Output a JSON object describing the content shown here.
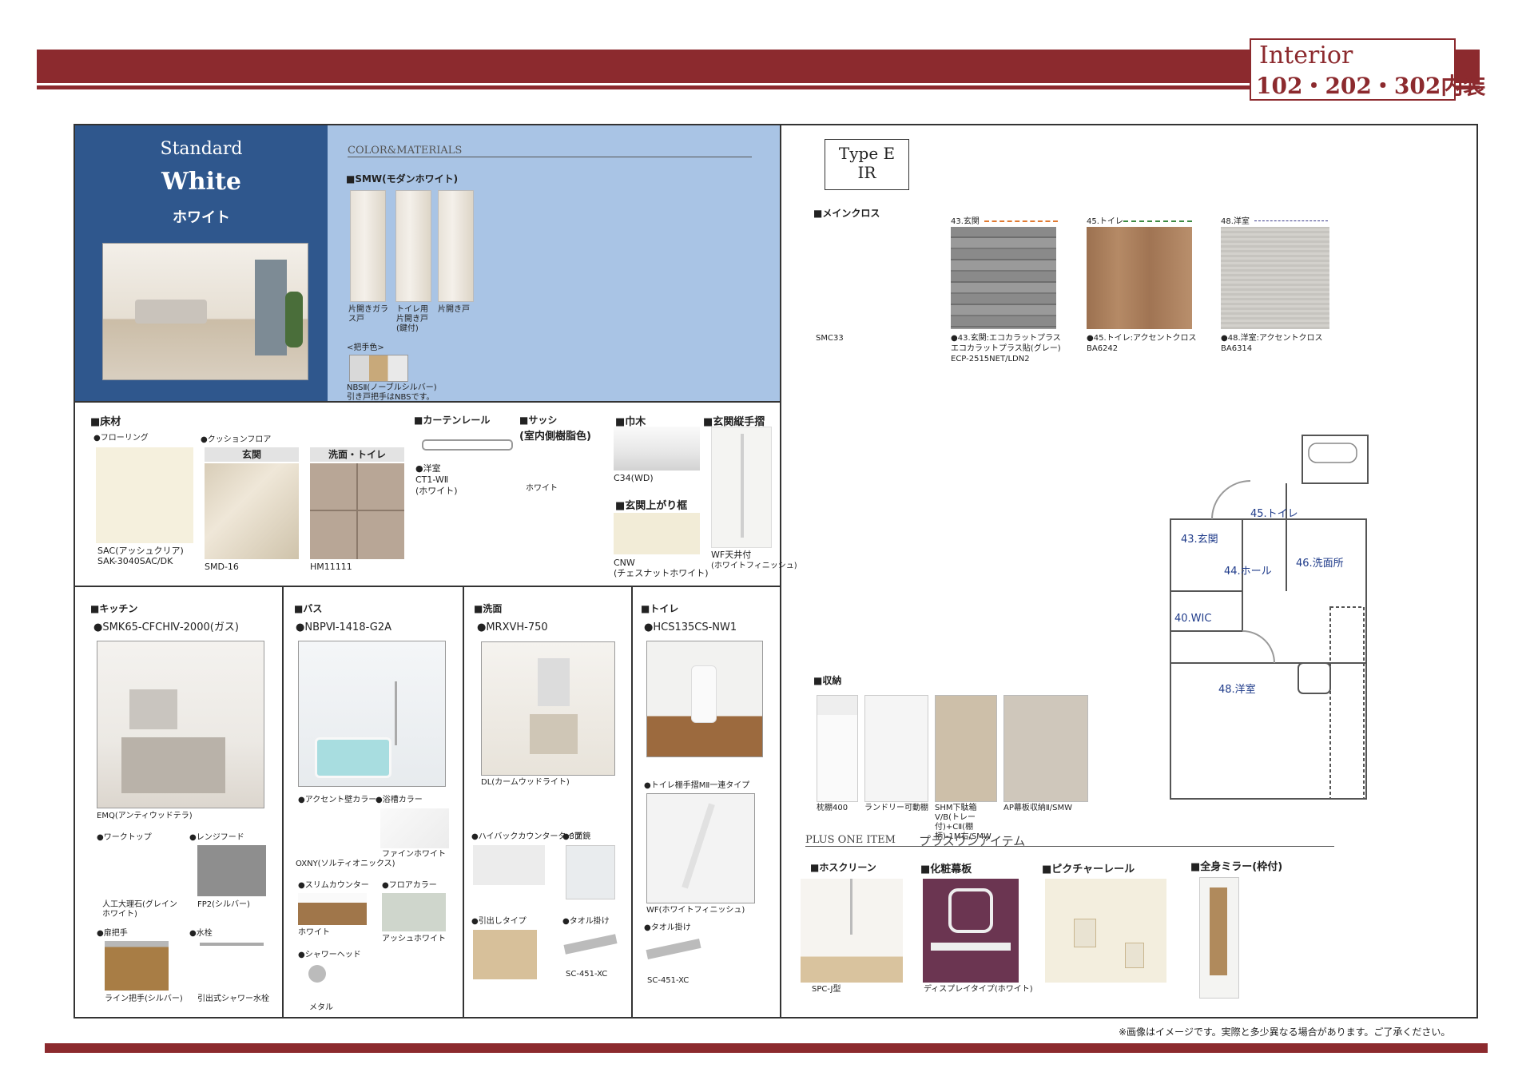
{
  "header": {
    "title_en": "Interior",
    "title_jp": "102・202・302内装"
  },
  "standard": {
    "label": "Standard",
    "color_en": "White",
    "color_jp": "ホワイト"
  },
  "materials": {
    "section_title": "COLOR&MATERIALS",
    "door_series": "■SMW(モダンホワイト)",
    "doors": [
      "片開きガラス戸",
      "トイレ用片開き戸(鍵付)",
      "片開き戸"
    ],
    "handle_title": "<把手色>",
    "handle_note_1": "NBSⅡ(ノーブルシルバー)",
    "handle_note_2": "引き戸把手はNBSです。"
  },
  "floor": {
    "title": "■床材",
    "flooring_label": "●フローリング",
    "flooring_code_1": "SAC(アッシュクリア)",
    "flooring_code_2": "SAK-3040SAC/DK",
    "cushion_label": "●クッションフロア",
    "cushion_genkan": "玄関",
    "cushion_wash": "洗面・トイレ",
    "cushion_code_1": "SMD-16",
    "cushion_code_2": "HM11111"
  },
  "curtain": {
    "title": "■カーテンレール",
    "room": "●洋室",
    "code": "CT1-WⅡ",
    "color": "(ホワイト)"
  },
  "sash": {
    "title": "■サッシ",
    "sub": "(室内側樹脂色)",
    "color": "ホワイト"
  },
  "baseboard": {
    "title": "■巾木",
    "code": "C34(WD)"
  },
  "entrance_frame": {
    "title": "■玄関上がり框",
    "code": "CNW",
    "color": "(チェスナットホワイト)"
  },
  "entrance_rail": {
    "title": "■玄関縦手摺",
    "code": "WF天井付",
    "color": "(ホワイトフィニッシュ)"
  },
  "kitchen": {
    "title": "■キッチン",
    "model": "●SMK65-CFCHⅣ-2000(ガス)",
    "finish": "EMQ(アンティウッドテラ)",
    "worktop_label": "●ワークトップ",
    "worktop_value_1": "人工大理石(グレイン",
    "worktop_value_2": "ホワイト)",
    "hood_label": "●レンジフード",
    "hood_value": "FP2(シルバー)",
    "handle_label": "●扉把手",
    "handle_value": "ライン把手(シルバー)",
    "faucet_label": "●水栓",
    "faucet_value": "引出式シャワー水栓"
  },
  "bath": {
    "title": "■バス",
    "model": "●NBPⅥ-1418-G2A",
    "accent_label": "●アクセント壁カラー",
    "accent_value": "OXNY(ソルティオニックス)",
    "tub_label": "●浴槽カラー",
    "tub_value": "ファインホワイト",
    "counter_label": "●スリムカウンター",
    "counter_value": "ホワイト",
    "floor_label": "●フロアカラー",
    "floor_value": "アッシュホワイト",
    "shower_label": "●シャワーヘッド",
    "shower_value": "メタル"
  },
  "washroom": {
    "title": "■洗面",
    "model": "●MRXVH-750",
    "finish": "DL(カームウッドライト)",
    "counter_label": "●ハイバックカウンタータイプ",
    "mirror_label": "●3面鏡",
    "drawer_label": "●引出しタイプ",
    "towel_label": "●タオル掛け",
    "towel_value": "SC-451-XC"
  },
  "toilet": {
    "title": "■トイレ",
    "model": "●HCS135CS-NW1",
    "shelf_label": "●トイレ棚手摺MⅡ一連タイプ",
    "shelf_value": "WF(ホワイトフィニッシュ)",
    "towel_label": "●タオル掛け",
    "towel_value": "SC-451-XC"
  },
  "type": {
    "line1": "Type E",
    "line2": "IR"
  },
  "cloth": {
    "title": "■メインクロス",
    "main_code": "SMC33",
    "swatches": [
      {
        "tag": "43.玄関",
        "desc_1": "●43.玄関:エコカラットプラス",
        "desc_2": "エコカラットプラス貼(グレー)",
        "code": "ECP-2515NET/LDN2",
        "color": "#7b7b7b"
      },
      {
        "tag": "45.トイレ",
        "desc_1": "●45.トイレ:アクセントクロス",
        "desc_2": "",
        "code": "BA6242",
        "color": "#a57a56"
      },
      {
        "tag": "48.洋室",
        "desc_1": "●48.洋室:アクセントクロス",
        "desc_2": "",
        "code": "BA6314",
        "color": "#c9c7c2"
      }
    ]
  },
  "floorplan": {
    "rooms": [
      "43.玄関",
      "45.トイレ",
      "44.ホール",
      "46.洗面所",
      "40.WIC",
      "48.洋室"
    ]
  },
  "storage": {
    "title": "■収納",
    "items": [
      "枕棚400",
      "ランドリー可動棚",
      "SHM下駄箱Ⅴ/B(トレー付)+CⅡ(棚柄)-1M右/SMW",
      "AP幕板収納Ⅱ/SMW"
    ]
  },
  "plusone": {
    "title_en": "PLUS ONE ITEM",
    "title_jp": "プラスワンアイテム",
    "items": [
      {
        "title": "■ホスクリーン",
        "code": "SPC-J型"
      },
      {
        "title": "■化粧幕板",
        "code": "ディスプレイタイプ(ホワイト)"
      },
      {
        "title": "■ピクチャーレール",
        "code": ""
      },
      {
        "title": "■全身ミラー(枠付)",
        "code": ""
      }
    ]
  },
  "footnote": "※画像はイメージです。実際と多少異なる場合があります。ご了承ください。"
}
